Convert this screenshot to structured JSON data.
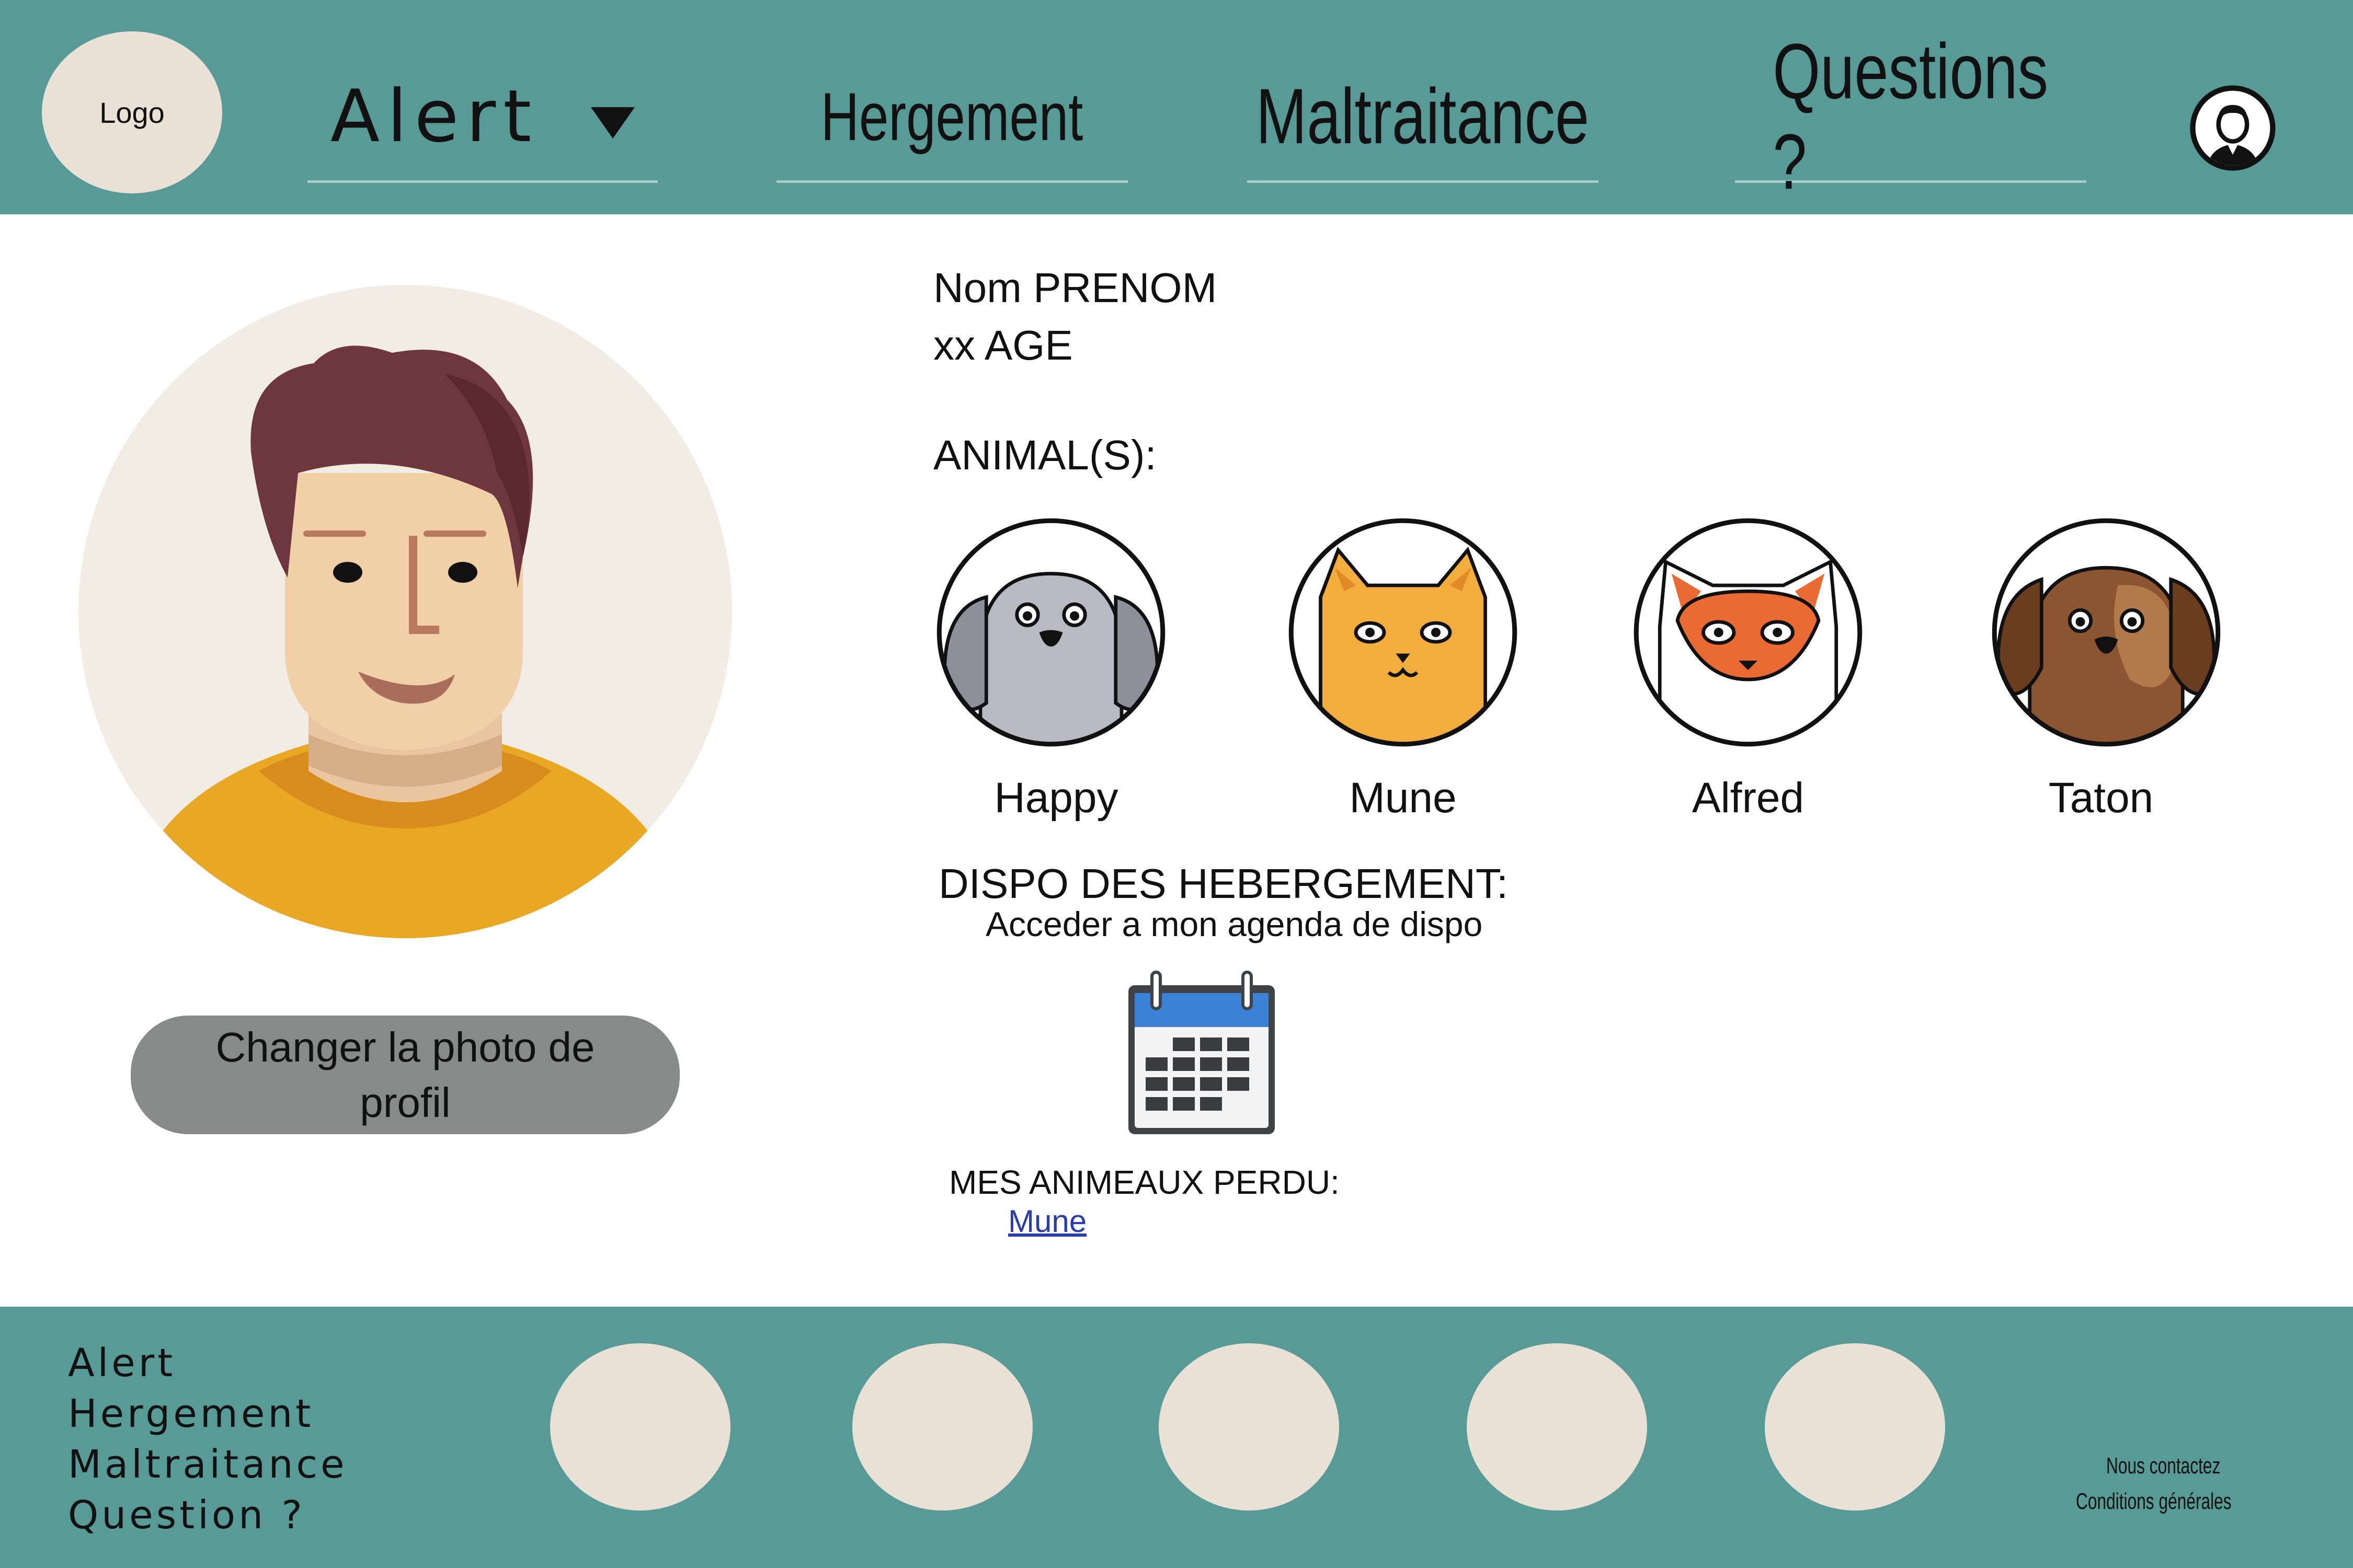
{
  "header": {
    "logo_text": "Logo",
    "nav": {
      "alert": "Alert",
      "hergement": "Hergement",
      "maltraitance": "Maltraitance",
      "questions": "Questions ?"
    }
  },
  "profile": {
    "change_photo_label": "Changer la photo de profil",
    "name": "Nom PRENOM",
    "age": "xx AGE",
    "animals_label": "ANIMAL(S):",
    "animals": [
      {
        "name": "Happy",
        "icon": "gray-dog-icon"
      },
      {
        "name": "Mune",
        "icon": "orange-cat-icon"
      },
      {
        "name": "Alfred",
        "icon": "fox-icon"
      },
      {
        "name": "Taton",
        "icon": "brown-dog-icon"
      }
    ],
    "dispo_label": "DISPO DES HEBERGEMENT:",
    "agenda_link": "Acceder a mon agenda de dispo",
    "lost_label": "MES ANIMEAUX PERDU:",
    "lost_animal": "Mune"
  },
  "footer": {
    "links": [
      "Alert",
      "Hergement",
      "Maltraitance",
      "Question ?"
    ],
    "contact": "Nous contactez",
    "terms": "Conditions générales"
  },
  "colors": {
    "teal": "#579a96",
    "beige": "#e9e0d6",
    "button_gray": "#888a89",
    "link_blue": "#2b3ea8"
  }
}
